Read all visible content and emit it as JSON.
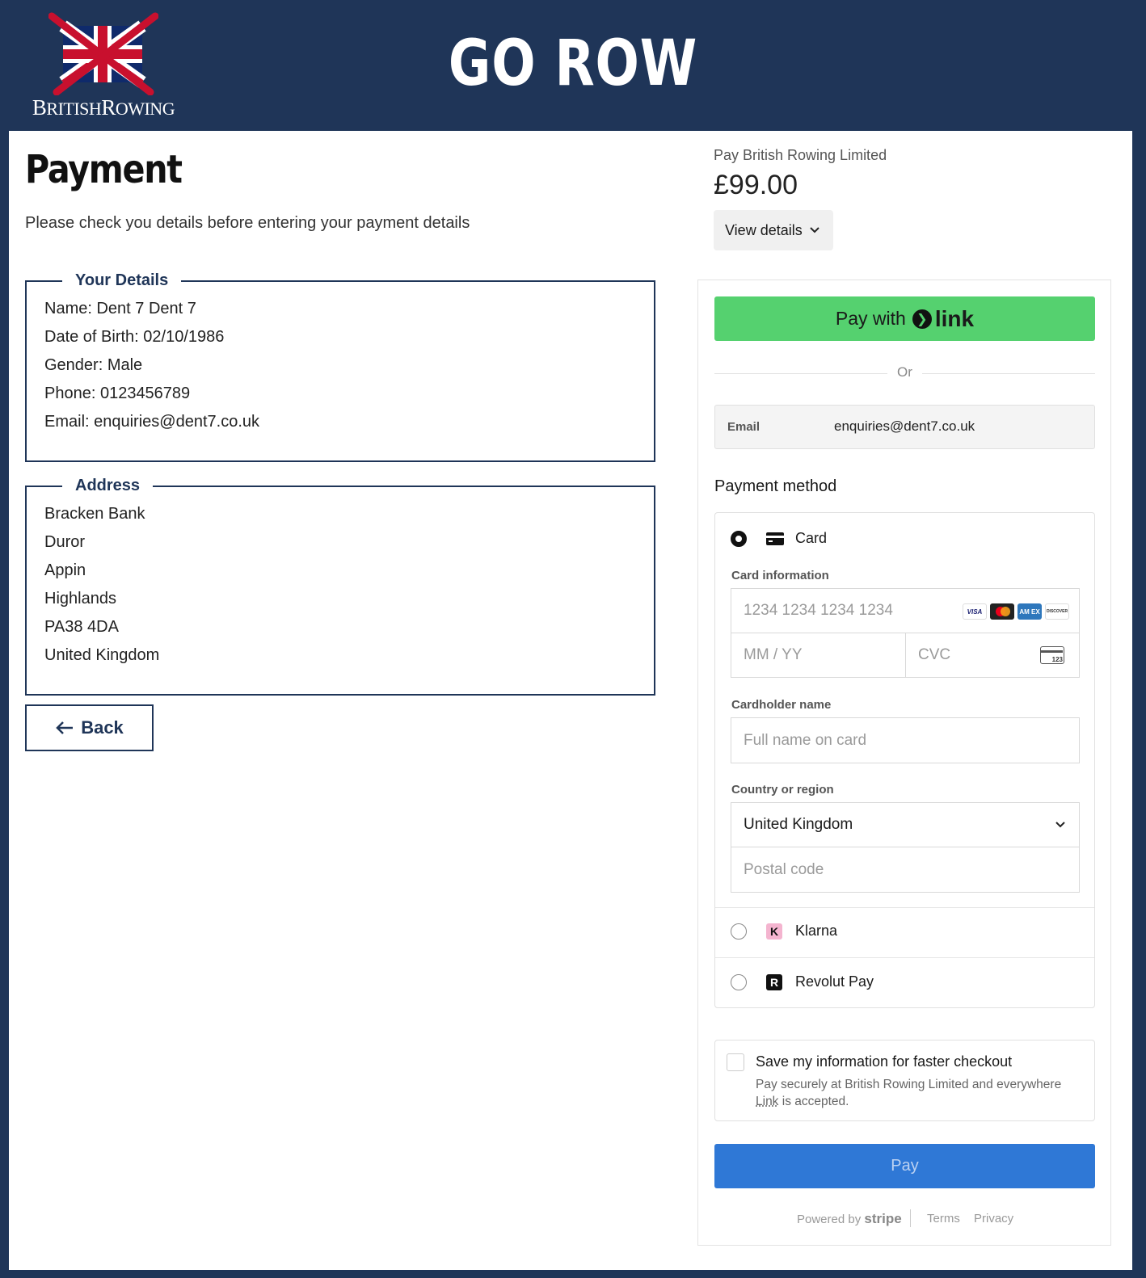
{
  "header": {
    "brand_logo_text": "BRITISHROWING",
    "logo_first_letter_1": "B",
    "logo_rest_1": "RITISH",
    "logo_first_letter_2": "R",
    "logo_rest_2": "OWING",
    "title": "GO ROW"
  },
  "page": {
    "title": "Payment",
    "subtitle": "Please check you details before entering your payment details"
  },
  "details": {
    "legend": "Your Details",
    "lines": [
      "Name: Dent 7 Dent 7",
      "Date of Birth: 02/10/1986",
      "Gender: Male",
      "Phone: 0123456789",
      "Email: enquiries@dent7.co.uk"
    ]
  },
  "address": {
    "legend": "Address",
    "lines": [
      "Bracken Bank",
      "Duror",
      "Appin",
      "Highlands",
      "PA38 4DA",
      "United Kingdom"
    ]
  },
  "back_label": "Back",
  "checkout": {
    "merchant": "Pay British Rowing Limited",
    "amount": "£99.00",
    "view_details": "View details",
    "link_pay_prefix": "Pay with",
    "link_brand": "link",
    "or": "Or",
    "email_label": "Email",
    "email_value": "enquiries@dent7.co.uk",
    "payment_method_title": "Payment method",
    "card_option": "Card",
    "card_info_label": "Card information",
    "card_number_placeholder": "1234 1234 1234 1234",
    "expiry_placeholder": "MM / YY",
    "cvc_placeholder": "CVC",
    "cvc_icon_text": "123",
    "card_brands": [
      "VISA",
      "",
      "AM EX",
      "DISCOVER"
    ],
    "cardholder_label": "Cardholder name",
    "cardholder_placeholder": "Full name on card",
    "country_label": "Country or region",
    "country_value": "United Kingdom",
    "postal_placeholder": "Postal code",
    "klarna_option": "Klarna",
    "klarna_icon": "K",
    "revolut_option": "Revolut Pay",
    "revolut_icon": "R",
    "save_title": "Save my information for faster checkout",
    "save_desc_1": "Pay securely at British Rowing Limited and everywhere",
    "save_desc_link": "Link",
    "save_desc_2": " is accepted.",
    "pay_label": "Pay",
    "powered_by": "Powered by",
    "stripe": "stripe",
    "terms": "Terms",
    "privacy": "Privacy"
  },
  "colors": {
    "navy": "#1f3558",
    "link_green": "#55d16f",
    "pay_blue": "#2f78d6"
  }
}
